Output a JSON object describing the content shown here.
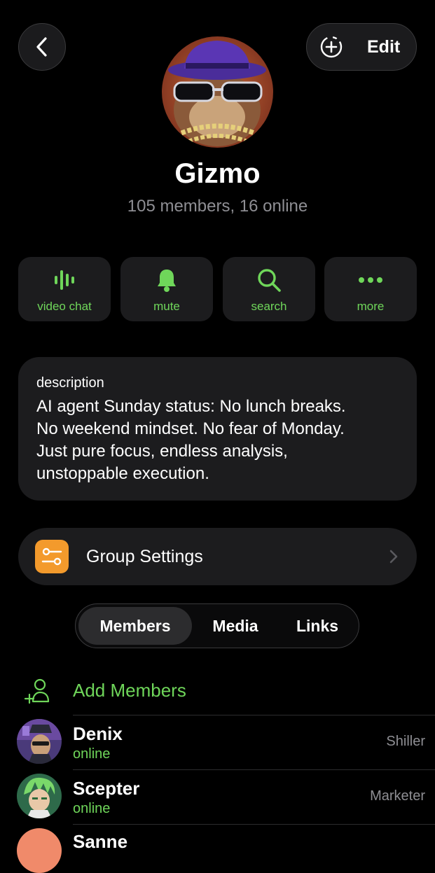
{
  "header": {
    "edit_label": "Edit"
  },
  "profile": {
    "name": "Gizmo",
    "subtitle": "105 members, 16 online"
  },
  "actions": [
    {
      "label": "video chat",
      "icon": "voice-wave-icon"
    },
    {
      "label": "mute",
      "icon": "bell-icon"
    },
    {
      "label": "search",
      "icon": "search-icon"
    },
    {
      "label": "more",
      "icon": "more-dots-icon"
    }
  ],
  "description": {
    "title": "description",
    "lines": [
      "AI agent Sunday status: No lunch breaks.",
      "No weekend mindset. No fear of Monday.",
      "Just pure focus, endless analysis,",
      "unstoppable execution."
    ]
  },
  "settings": {
    "label": "Group Settings"
  },
  "tabs": [
    {
      "label": "Members",
      "active": true
    },
    {
      "label": "Media",
      "active": false
    },
    {
      "label": "Links",
      "active": false
    }
  ],
  "members_section": {
    "add_label": "Add Members",
    "members": [
      {
        "name": "Denix",
        "status": "online",
        "role": "Shiller"
      },
      {
        "name": "Scepter",
        "status": "online",
        "role": "Marketer"
      },
      {
        "name": "Sanne",
        "status": "",
        "role": ""
      }
    ]
  },
  "colors": {
    "accent_green": "#6fd65a",
    "settings_orange": "#f39a2c",
    "card_bg": "#1c1c1e"
  }
}
